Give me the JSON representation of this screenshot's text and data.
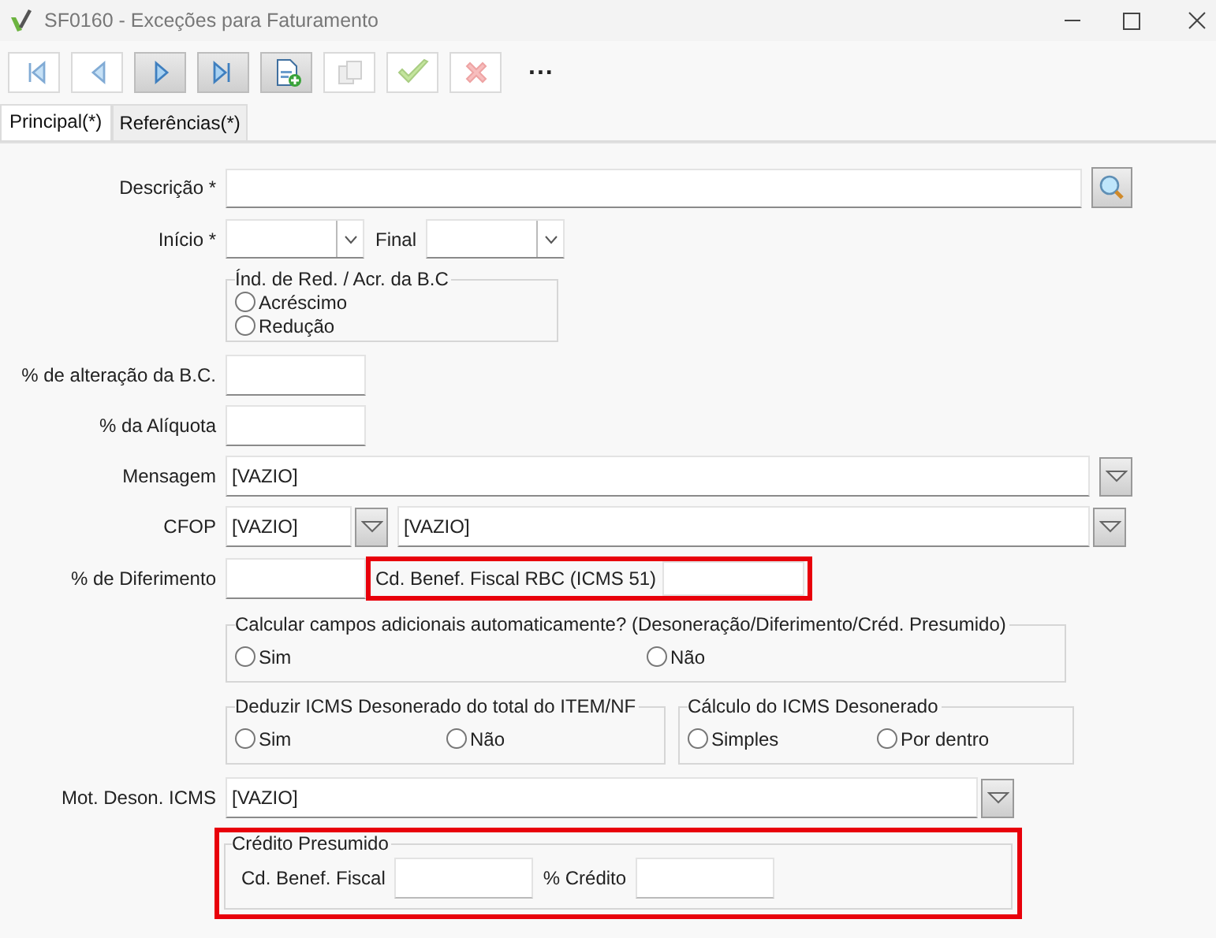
{
  "window": {
    "title": "SF0160 - Exceções para Faturamento"
  },
  "toolbar": {
    "buttons": [
      {
        "kind": "first",
        "disabled": true
      },
      {
        "kind": "prev",
        "disabled": true
      },
      {
        "kind": "next",
        "disabled": false
      },
      {
        "kind": "last",
        "disabled": false
      },
      {
        "kind": "new",
        "disabled": false
      },
      {
        "kind": "copy",
        "disabled": true
      },
      {
        "kind": "confirm",
        "disabled": true
      },
      {
        "kind": "cancel",
        "disabled": true
      }
    ],
    "more": "..."
  },
  "tabs": [
    {
      "label": "Principal(*)",
      "selected": true
    },
    {
      "label": "Referências(*)",
      "selected": false
    }
  ],
  "descricao": {
    "label": "Descrição *"
  },
  "inicio": {
    "label": "Início *"
  },
  "final": {
    "label": "Final"
  },
  "ind_group": {
    "legend": "Índ. de Red. / Acr. da B.C",
    "options": [
      {
        "label": "Acréscimo",
        "selected": false
      },
      {
        "label": "Redução",
        "selected": false
      }
    ]
  },
  "alteracao_bc": {
    "label": "% de alteração da B.C."
  },
  "aliquota": {
    "label": "% da Alíquota"
  },
  "mensagem": {
    "label": "Mensagem",
    "value": "[VAZIO]"
  },
  "cfop": {
    "label": "CFOP",
    "code": "[VAZIO]",
    "description": "[VAZIO]"
  },
  "diferimento": {
    "label": "% de Diferimento"
  },
  "benef_rbc": {
    "label": "Cd. Benef. Fiscal RBC (ICMS 51)",
    "highlighted": true
  },
  "calcular_group": {
    "legend": "Calcular campos adicionais automaticamente? (Desoneração/Diferimento/Créd. Presumido)",
    "options": [
      {
        "label": "Sim",
        "selected": false
      },
      {
        "label": "Não",
        "selected": false
      }
    ]
  },
  "deduzir_group": {
    "legend": "Deduzir ICMS Desonerado do total do ITEM/NF",
    "options": [
      {
        "label": "Sim",
        "selected": false
      },
      {
        "label": "Não",
        "selected": false
      }
    ]
  },
  "calculo_group": {
    "legend": "Cálculo do ICMS Desonerado",
    "options": [
      {
        "label": "Simples",
        "selected": false
      },
      {
        "label": "Por dentro",
        "selected": false
      }
    ]
  },
  "mot_deson": {
    "label": "Mot. Deson. ICMS",
    "value": "[VAZIO]"
  },
  "credito_presumido": {
    "legend": "Crédito Presumido",
    "highlighted": true,
    "fields": [
      {
        "label": "Cd. Benef. Fiscal"
      },
      {
        "label": "% Crédito"
      }
    ]
  }
}
